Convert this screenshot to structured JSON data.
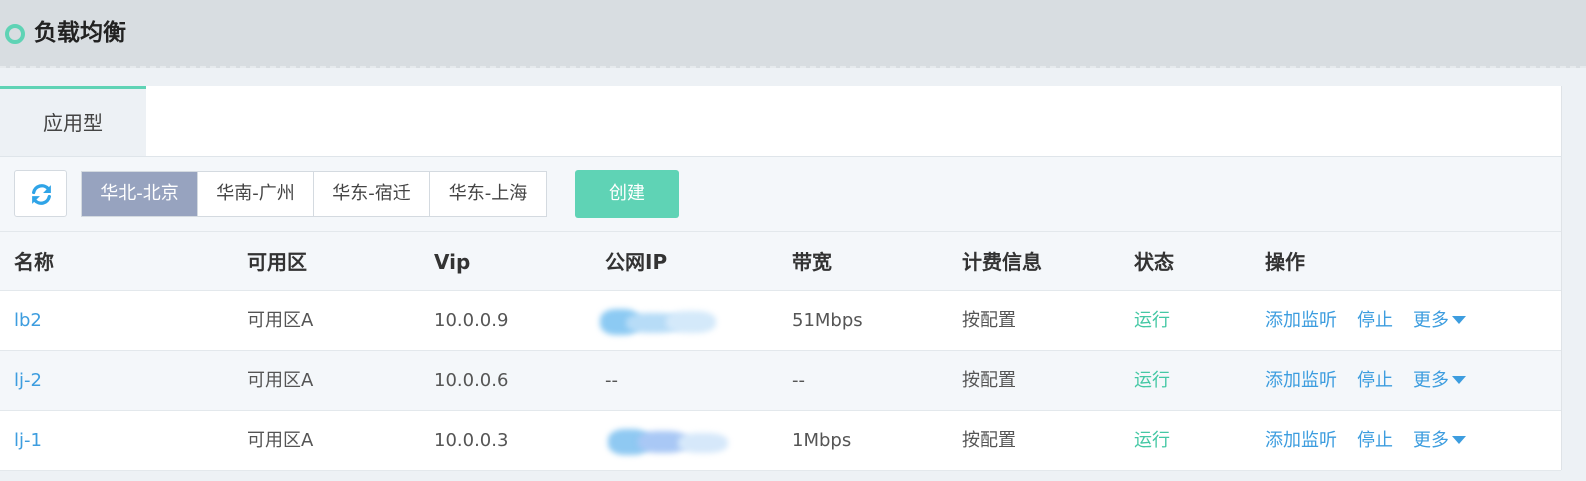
{
  "header": {
    "title": "负载均衡",
    "accent_color": "#5fd3b5"
  },
  "tabs": [
    {
      "label": "应用型",
      "active": true
    }
  ],
  "toolbar": {
    "refresh_icon": "refresh-icon",
    "regions": [
      {
        "label": "华北-北京",
        "active": true
      },
      {
        "label": "华南-广州",
        "active": false
      },
      {
        "label": "华东-宿迁",
        "active": false
      },
      {
        "label": "华东-上海",
        "active": false
      }
    ],
    "create_label": "创建"
  },
  "table": {
    "columns": [
      "名称",
      "可用区",
      "Vip",
      "公网IP",
      "带宽",
      "计费信息",
      "状态",
      "操作"
    ],
    "rows": [
      {
        "name": "lb2",
        "zone": "可用区A",
        "vip": "10.0.0.9",
        "public_ip": "",
        "public_ip_obscured": true,
        "bandwidth": "51Mbps",
        "billing": "按配置",
        "status": "运行",
        "op_listen": "添加监听",
        "op_stop": "停止",
        "op_more": "更多"
      },
      {
        "name": "lj-2",
        "zone": "可用区A",
        "vip": "10.0.0.6",
        "public_ip": "--",
        "public_ip_obscured": false,
        "bandwidth": "--",
        "billing": "按配置",
        "status": "运行",
        "op_listen": "添加监听",
        "op_stop": "停止",
        "op_more": "更多"
      },
      {
        "name": "lj-1",
        "zone": "可用区A",
        "vip": "10.0.0.3",
        "public_ip": "",
        "public_ip_obscured": true,
        "bandwidth": "1Mbps",
        "billing": "按配置",
        "status": "运行",
        "op_listen": "添加监听",
        "op_stop": "停止",
        "op_more": "更多"
      }
    ]
  },
  "colors": {
    "link": "#3d9ddf",
    "status_running": "#44c8a4",
    "create_button": "#5fd3b5",
    "region_active": "#97a3bf"
  }
}
